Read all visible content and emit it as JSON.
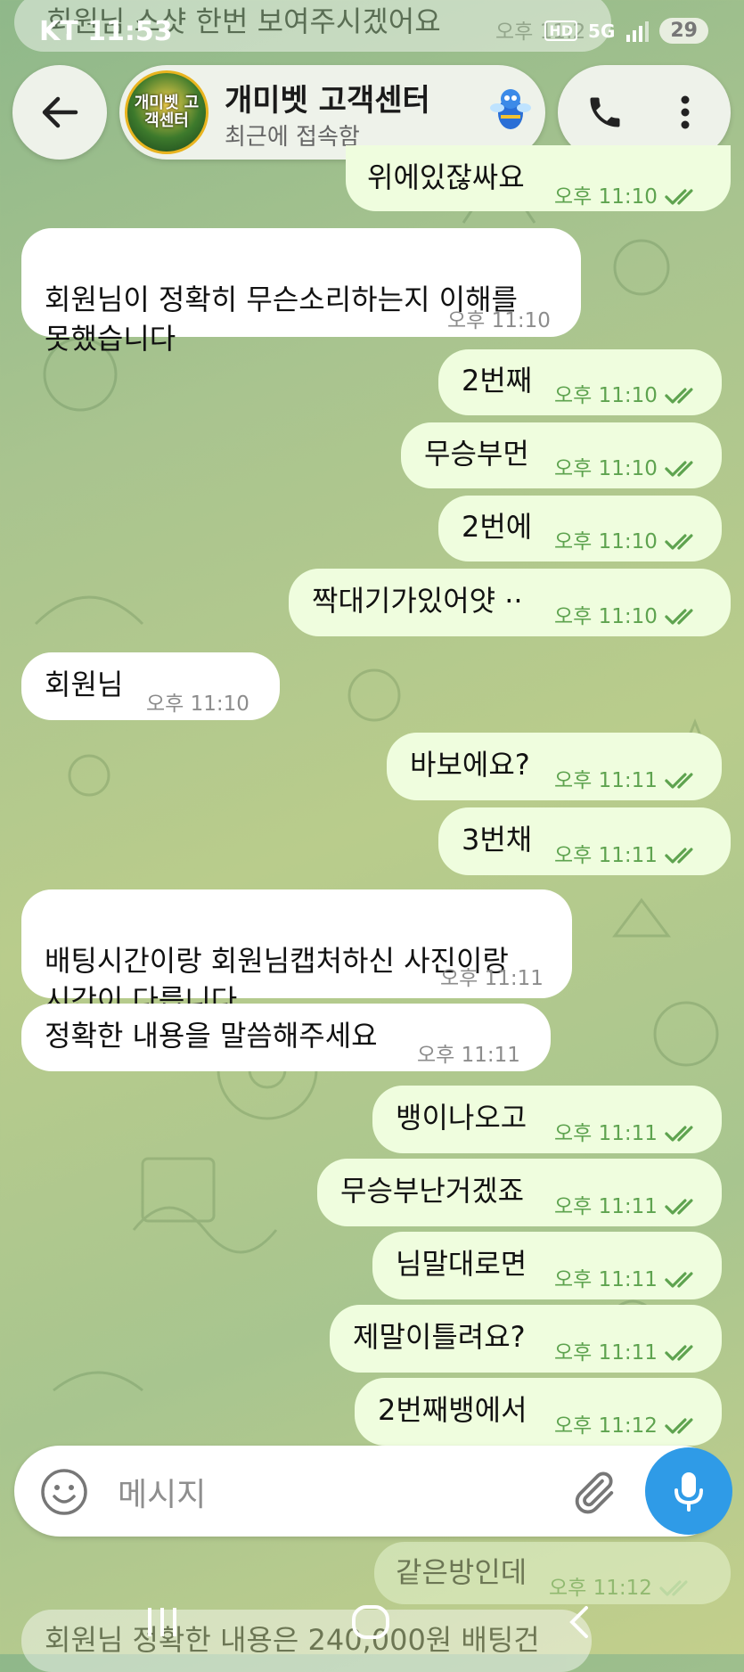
{
  "status_bar": {
    "carrier": "KT",
    "time": "11:53",
    "battery": "29",
    "network": "5G"
  },
  "header": {
    "title": "개미벳 고객센터",
    "subtitle": "최근에 접속함",
    "avatar_text": "개미벳 고객센터"
  },
  "faded_top_message": "회원님 스샷 한번 보여주시겠어요",
  "faded_top_time": "오후 11:2",
  "messages": [
    {
      "dir": "out",
      "text": "위에있잖싸요",
      "time": "오후 11:10"
    },
    {
      "dir": "in",
      "text": "회원님이 정확히 무슨소리하는지 이해를\n못했습니다",
      "time": "오후 11:10"
    },
    {
      "dir": "out",
      "text": "2번째",
      "time": "오후 11:10"
    },
    {
      "dir": "out",
      "text": "무승부먼",
      "time": "오후 11:10"
    },
    {
      "dir": "out",
      "text": "2번에",
      "time": "오후 11:10"
    },
    {
      "dir": "out",
      "text": "짝대기가있어얏 ··",
      "time": "오후 11:10"
    },
    {
      "dir": "in",
      "text": "회원님",
      "time": "오후 11:10"
    },
    {
      "dir": "out",
      "text": "바보에요?",
      "time": "오후 11:11"
    },
    {
      "dir": "out",
      "text": "3번채",
      "time": "오후 11:11"
    },
    {
      "dir": "in",
      "text": "배팅시간이랑 회원님캡처하신 사진이랑\n시간이 다릅니다",
      "time": "오후 11:11"
    },
    {
      "dir": "in",
      "text": "정확한 내용을 말씀해주세요",
      "time": "오후 11:11"
    },
    {
      "dir": "out",
      "text": "뱅이나오고",
      "time": "오후 11:11"
    },
    {
      "dir": "out",
      "text": "무승부난거겠죠",
      "time": "오후 11:11"
    },
    {
      "dir": "out",
      "text": "님말대로면",
      "time": "오후 11:11"
    },
    {
      "dir": "out",
      "text": "제말이틀려요?",
      "time": "오후 11:11"
    },
    {
      "dir": "out",
      "text": "2번째뱅에서",
      "time": "오후 11:12"
    }
  ],
  "behind_messages": [
    {
      "text": "같은방인데",
      "time": "오후 11:12"
    },
    {
      "text": "회원님 정확한 내용은 240,000원 배팅건",
      "time": ""
    }
  ],
  "composer": {
    "placeholder": "메시지"
  },
  "colors": {
    "incoming_bubble": "#ffffff",
    "outgoing_bubble": "#effdde",
    "outgoing_time": "#5ea34f",
    "mic_button": "#2f9be7"
  }
}
